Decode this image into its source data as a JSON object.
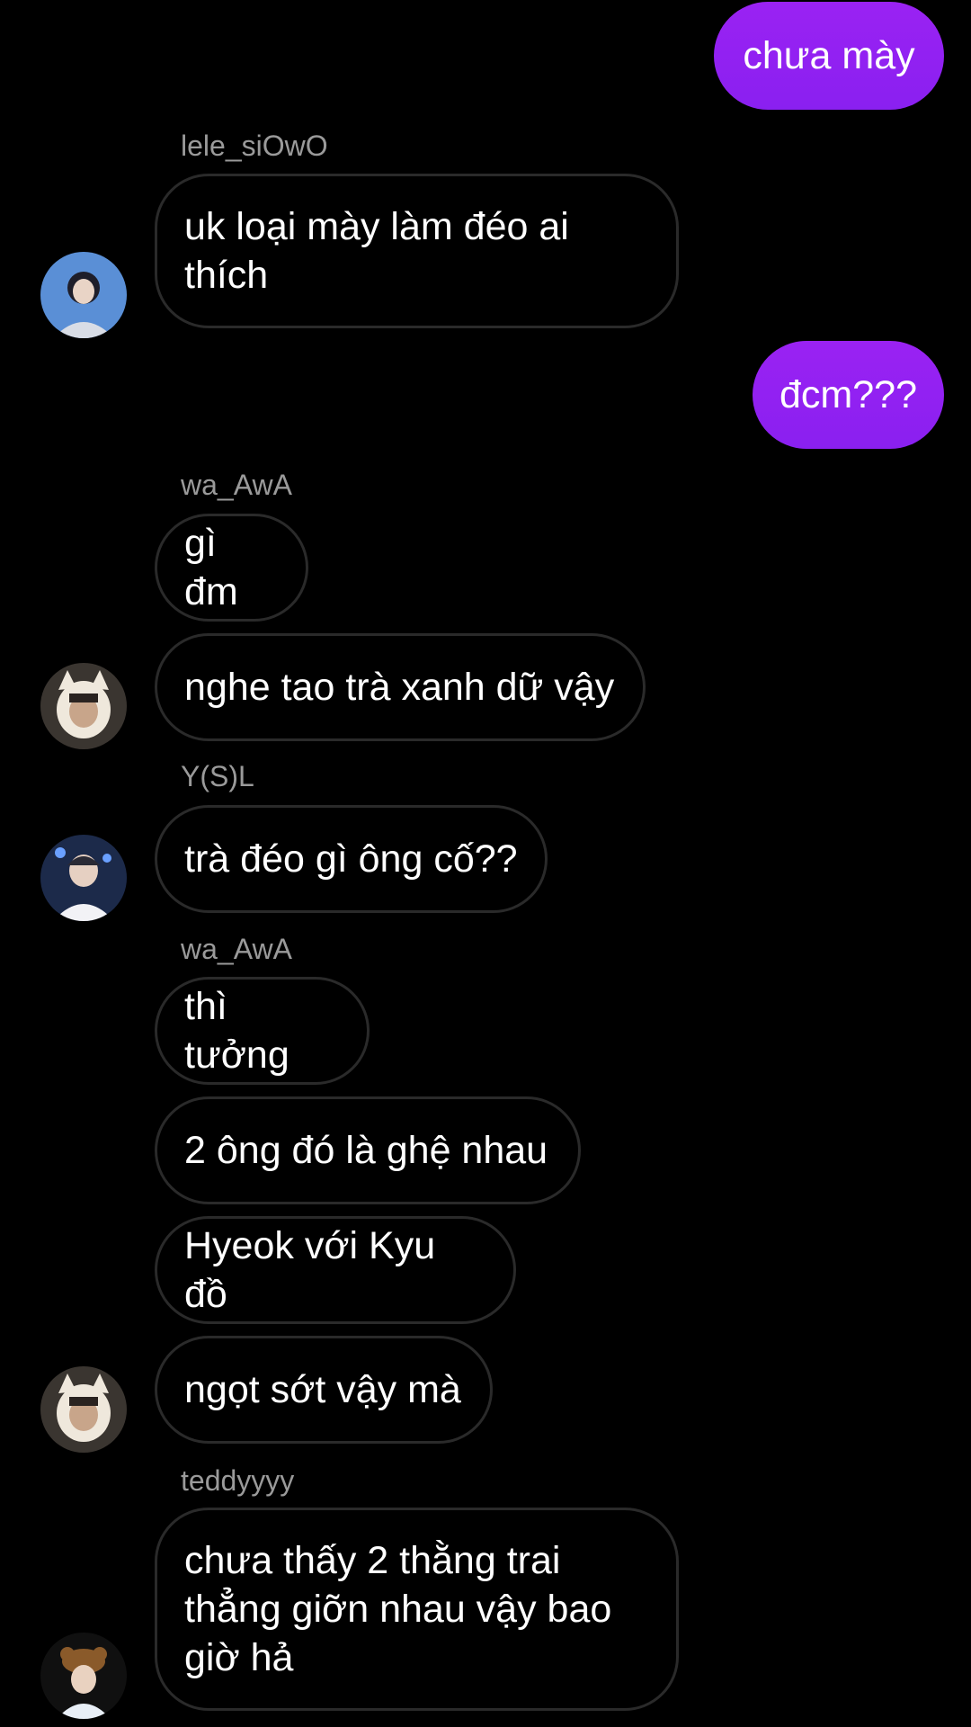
{
  "messages": {
    "out1": "chưa mày",
    "out2": "đcm???",
    "in1": "uk loại mày làm đéo ai thích",
    "in2": "gì đm",
    "in3": "nghe tao trà xanh dữ vậy",
    "in4": "trà đéo gì ông cố??",
    "in5": "thì tưởng",
    "in6": "2 ông đó là ghệ nhau",
    "in7": "Hyeok với Kyu đồ",
    "in8": "ngọt sớt vậy mà",
    "in9": "chưa thấy 2 thằng trai thẳng giỡn nhau vậy bao giờ hả"
  },
  "senders": {
    "s1": "lele_siOwO",
    "s2": "wa_AwA",
    "s3": "Y(S)L",
    "s4": "wa_AwA",
    "s5": "teddyyyy"
  },
  "avatars": {
    "a1": "profile-photo-icon",
    "a2": "profile-photo-icon",
    "a3": "profile-photo-icon",
    "a4": "profile-photo-icon",
    "a5": "profile-photo-icon"
  },
  "colors": {
    "background": "#000000",
    "outgoing_bubble": "#8a20f0",
    "incoming_border": "#2a2a2a",
    "sender_text": "#9a9a9a"
  }
}
